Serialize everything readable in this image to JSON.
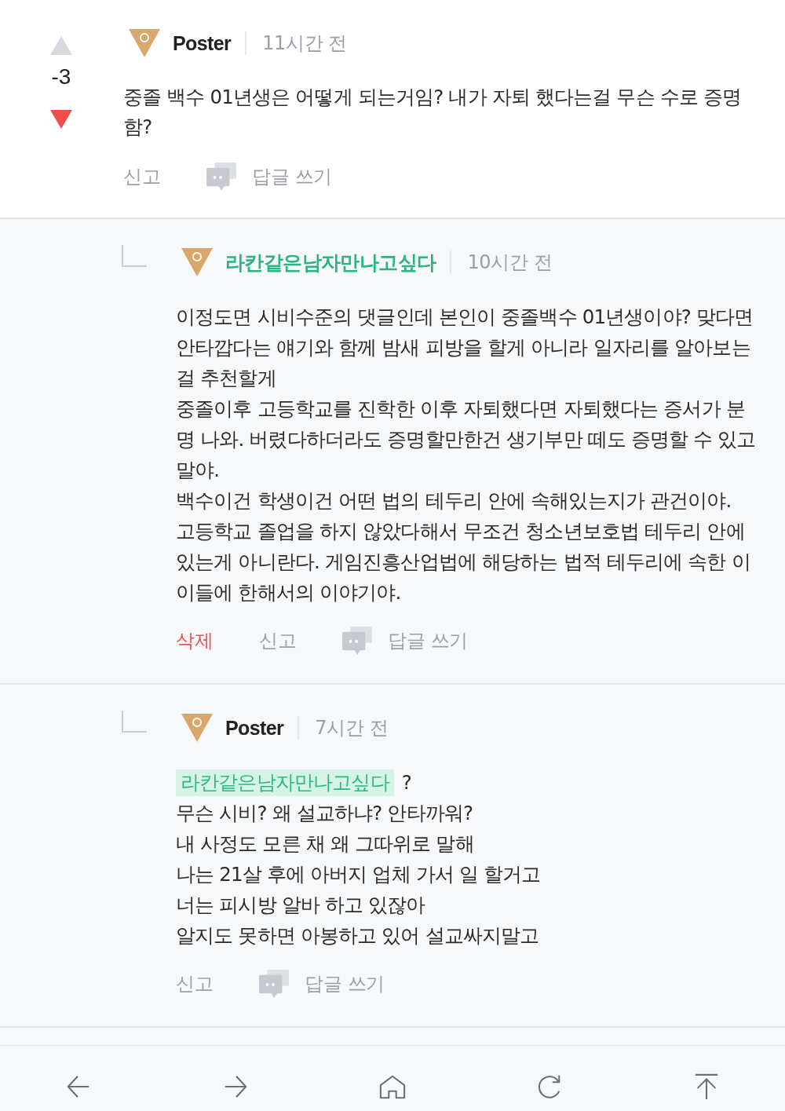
{
  "comments": [
    {
      "kind": "top",
      "votes": {
        "score": "-3",
        "upvoted": false,
        "downvoted": true
      },
      "author": {
        "name": "Poster",
        "color": "#222222"
      },
      "time": "11시간 전",
      "body": [
        {
          "kind": "text",
          "text": "중졸 백수 01년생은 어떻게 되는거임? 내가 자퇴 했다는걸 무슨 수로 증명함?"
        }
      ],
      "actions": [
        {
          "kind": "report",
          "label": "신고"
        },
        {
          "kind": "reply",
          "label": "답글 쓰기"
        }
      ]
    },
    {
      "kind": "reply",
      "author": {
        "name": "라칸같은남자만나고싶다",
        "color": "#2bb380"
      },
      "time": "10시간 전",
      "body": [
        {
          "kind": "text",
          "text": "이정도면 시비수준의 댓글인데 본인이 중졸백수 01년생이야? 맞다면 안타깝다는 얘기와 함께 밤새 피방을 할게 아니라 일자리를 알아보는 걸 추천할게"
        },
        {
          "kind": "text",
          "text": "중졸이후 고등학교를 진학한 이후 자퇴했다면 자퇴했다는 증서가 분명 나와. 버렸다하더라도 증명할만한건 생기부만 떼도 증명할 수 있고 말야."
        },
        {
          "kind": "text",
          "text": "백수이건 학생이건 어떤 법의 테두리 안에 속해있는지가 관건이야."
        },
        {
          "kind": "text",
          "text": "고등학교 졸업을 하지 않았다해서 무조건 청소년보호법 테두리 안에 있는게 아니란다. 게임진흥산업법에 해당하는 법적 테두리에 속한 이이들에 한해서의 이야기야."
        }
      ],
      "actions": [
        {
          "kind": "delete",
          "label": "삭제"
        },
        {
          "kind": "report",
          "label": "신고"
        },
        {
          "kind": "reply",
          "label": "답글 쓰기"
        }
      ]
    },
    {
      "kind": "reply",
      "author": {
        "name": "Poster",
        "color": "#222222"
      },
      "time": "7시간 전",
      "body": [
        {
          "kind": "mention",
          "name": "라칸같은남자만나고싶다",
          "text": "?"
        },
        {
          "kind": "text",
          "text": "무슨 시비? 왜 설교하냐? 안타까워?"
        },
        {
          "kind": "text",
          "text": "내 사정도 모른 채 왜 그따위로 말해"
        },
        {
          "kind": "text",
          "text": "나는 21살 후에 아버지 업체 가서 일 할거고"
        },
        {
          "kind": "text",
          "text": "너는 피시방 알바 하고 있잖아"
        },
        {
          "kind": "text",
          "text": "알지도 못하면 아봉하고 있어 설교싸지말고"
        }
      ],
      "actions": [
        {
          "kind": "report",
          "label": "신고"
        },
        {
          "kind": "reply",
          "label": "답글 쓰기"
        }
      ]
    }
  ]
}
